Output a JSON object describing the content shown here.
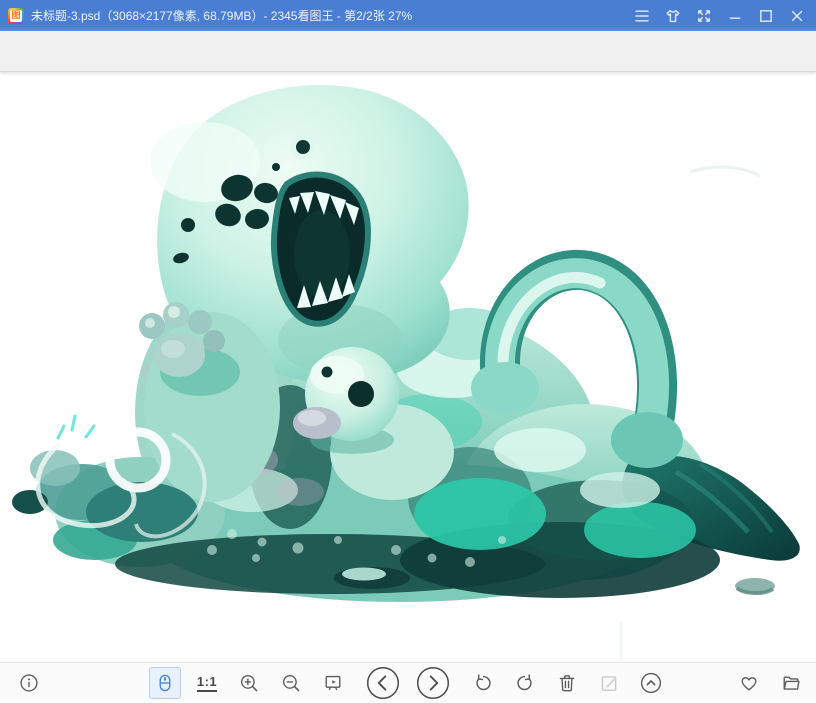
{
  "titlebar": {
    "title": "未标题-3.psd（3068×2177像素, 68.79MB）- 2345看图王 - 第2/2张 27%",
    "file_name": "未标题-3.psd",
    "image_dimensions": "3068×2177像素",
    "file_size": "68.79MB",
    "app_name": "2345看图王",
    "page_indicator": "第2/2张",
    "zoom_level": "27%",
    "app_icon_glyph": "图",
    "controls": [
      {
        "name": "main-menu",
        "icon": "hamburger-icon"
      },
      {
        "name": "skin-theme",
        "icon": "tshirt-icon"
      },
      {
        "name": "fullscreen",
        "icon": "expand-arrows-icon"
      },
      {
        "name": "minimize",
        "icon": "minimize-icon"
      },
      {
        "name": "maximize",
        "icon": "maximize-icon"
      },
      {
        "name": "close",
        "icon": "close-icon"
      }
    ]
  },
  "toolbar": {
    "buttons": [
      {
        "name": "image-info",
        "icon": "info-circle-icon"
      },
      {
        "name": "pan-tool",
        "icon": "mouse-icon",
        "active": true
      },
      {
        "name": "actual-size",
        "label": "1:1"
      },
      {
        "name": "zoom-in",
        "icon": "magnifier-plus-icon"
      },
      {
        "name": "zoom-out",
        "icon": "magnifier-minus-icon"
      },
      {
        "name": "slideshow",
        "icon": "slideshow-play-icon"
      },
      {
        "name": "previous-image",
        "icon": "chevron-left-circle-icon"
      },
      {
        "name": "next-image",
        "icon": "chevron-right-circle-icon"
      },
      {
        "name": "rotate-left",
        "icon": "rotate-ccw-icon"
      },
      {
        "name": "rotate-right",
        "icon": "rotate-cw-icon"
      },
      {
        "name": "delete-image",
        "icon": "trash-icon"
      },
      {
        "name": "edit-image",
        "icon": "pencil-square-icon",
        "disabled": true
      },
      {
        "name": "collapse-bar",
        "icon": "chevron-up-circle-icon"
      },
      {
        "name": "favorite",
        "icon": "heart-icon"
      },
      {
        "name": "open-folder",
        "icon": "folder-icon"
      }
    ]
  },
  "colors": {
    "titlebar_blue": "#4a7ed2",
    "accent_blue": "#4a86d8",
    "active_tool_bg": "#e9f2fc",
    "active_tool_border": "#b5d0ef",
    "ribbon_gray": "#f1f1f1",
    "icon_gray": "#5c5c5c",
    "creature_mint": "#cdf2e5",
    "creature_teal": "#2cc9a8",
    "creature_dark_teal": "#0d3b38"
  }
}
